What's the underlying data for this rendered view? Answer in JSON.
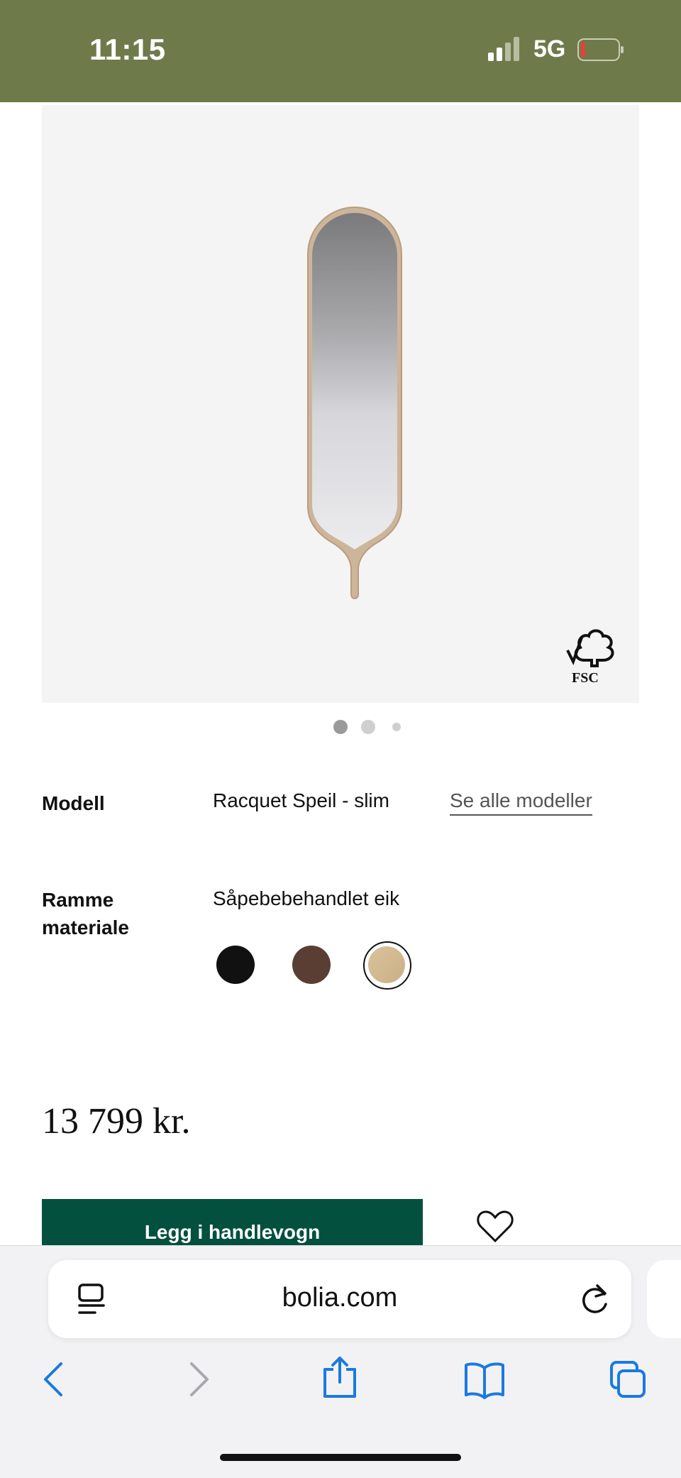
{
  "status_bar": {
    "time": "11:15",
    "network": "5G",
    "background": "#6f7a4b"
  },
  "product": {
    "image_badge_text": "FSC",
    "image_count": 3,
    "active_image_index": 0
  },
  "specs": {
    "model": {
      "label": "Modell",
      "value": "Racquet Speil - slim",
      "link": "Se alle modeller"
    },
    "frame_material": {
      "label_line1": "Ramme",
      "label_line2": "materiale",
      "value": "Såpebebehandlet eik",
      "swatches": [
        {
          "name": "black",
          "color": "#111111",
          "selected": false
        },
        {
          "name": "brown",
          "color": "#5a3e33",
          "selected": false
        },
        {
          "name": "soaped-oak",
          "color": "#d6bc93",
          "selected": true
        }
      ]
    }
  },
  "price": "13 799 kr.",
  "cart": {
    "add_label": "Legg i handlevogn",
    "button_color": "#03503f"
  },
  "browser": {
    "url": "bolia.com",
    "icons": [
      "reader-icon",
      "reload-icon",
      "back-icon",
      "forward-icon",
      "share-icon",
      "bookmarks-icon",
      "tabs-icon"
    ],
    "accent": "#1a7ae0"
  }
}
